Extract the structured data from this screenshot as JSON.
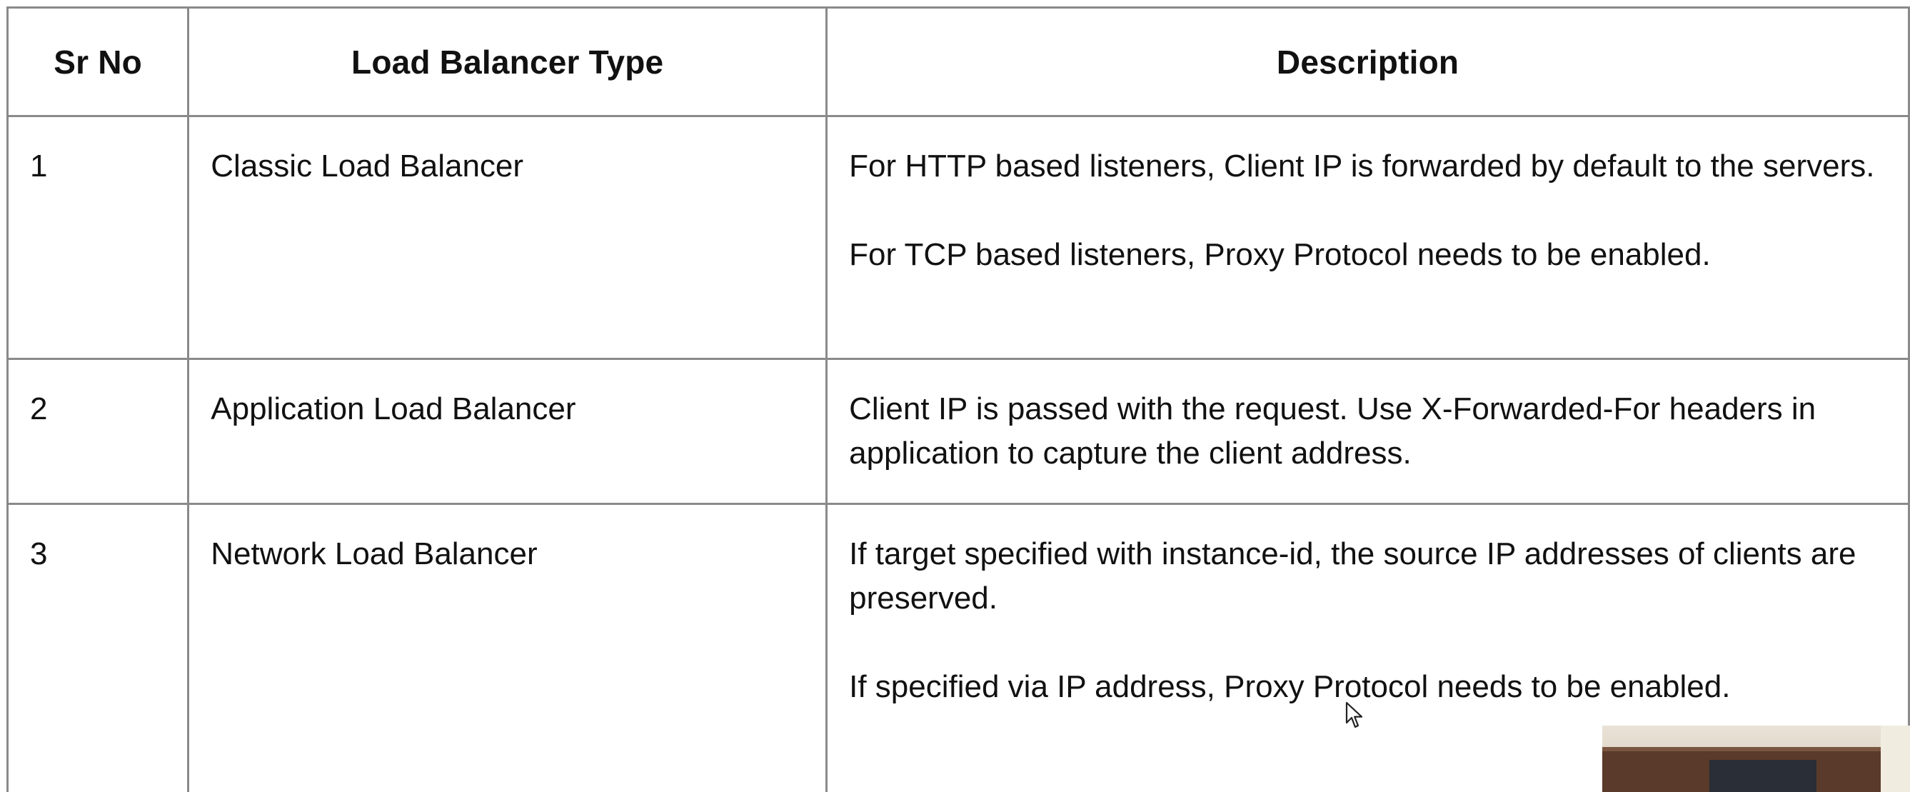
{
  "table": {
    "headers": [
      "Sr No",
      "Load Balancer Type",
      "Description"
    ],
    "rows": [
      {
        "sr_no": "1",
        "type": "Classic Load Balancer",
        "description": [
          "For HTTP based listeners, Client IP is forwarded by default to the servers.",
          "For TCP based listeners, Proxy Protocol needs to be enabled."
        ]
      },
      {
        "sr_no": "2",
        "type": "Application Load Balancer",
        "description": [
          "Client IP is passed with the request. Use X-Forwarded-For headers in application to capture the client address."
        ]
      },
      {
        "sr_no": "3",
        "type": "Network Load Balancer",
        "description": [
          "If target specified with instance-id, the source IP addresses of clients are preserved.",
          "If specified via IP address, Proxy Protocol needs to be enabled."
        ]
      }
    ]
  },
  "colors": {
    "border": "#8a8a8a",
    "text": "#111111",
    "background": "#ffffff"
  },
  "icons": {
    "cursor": "mouse-pointer-icon"
  }
}
